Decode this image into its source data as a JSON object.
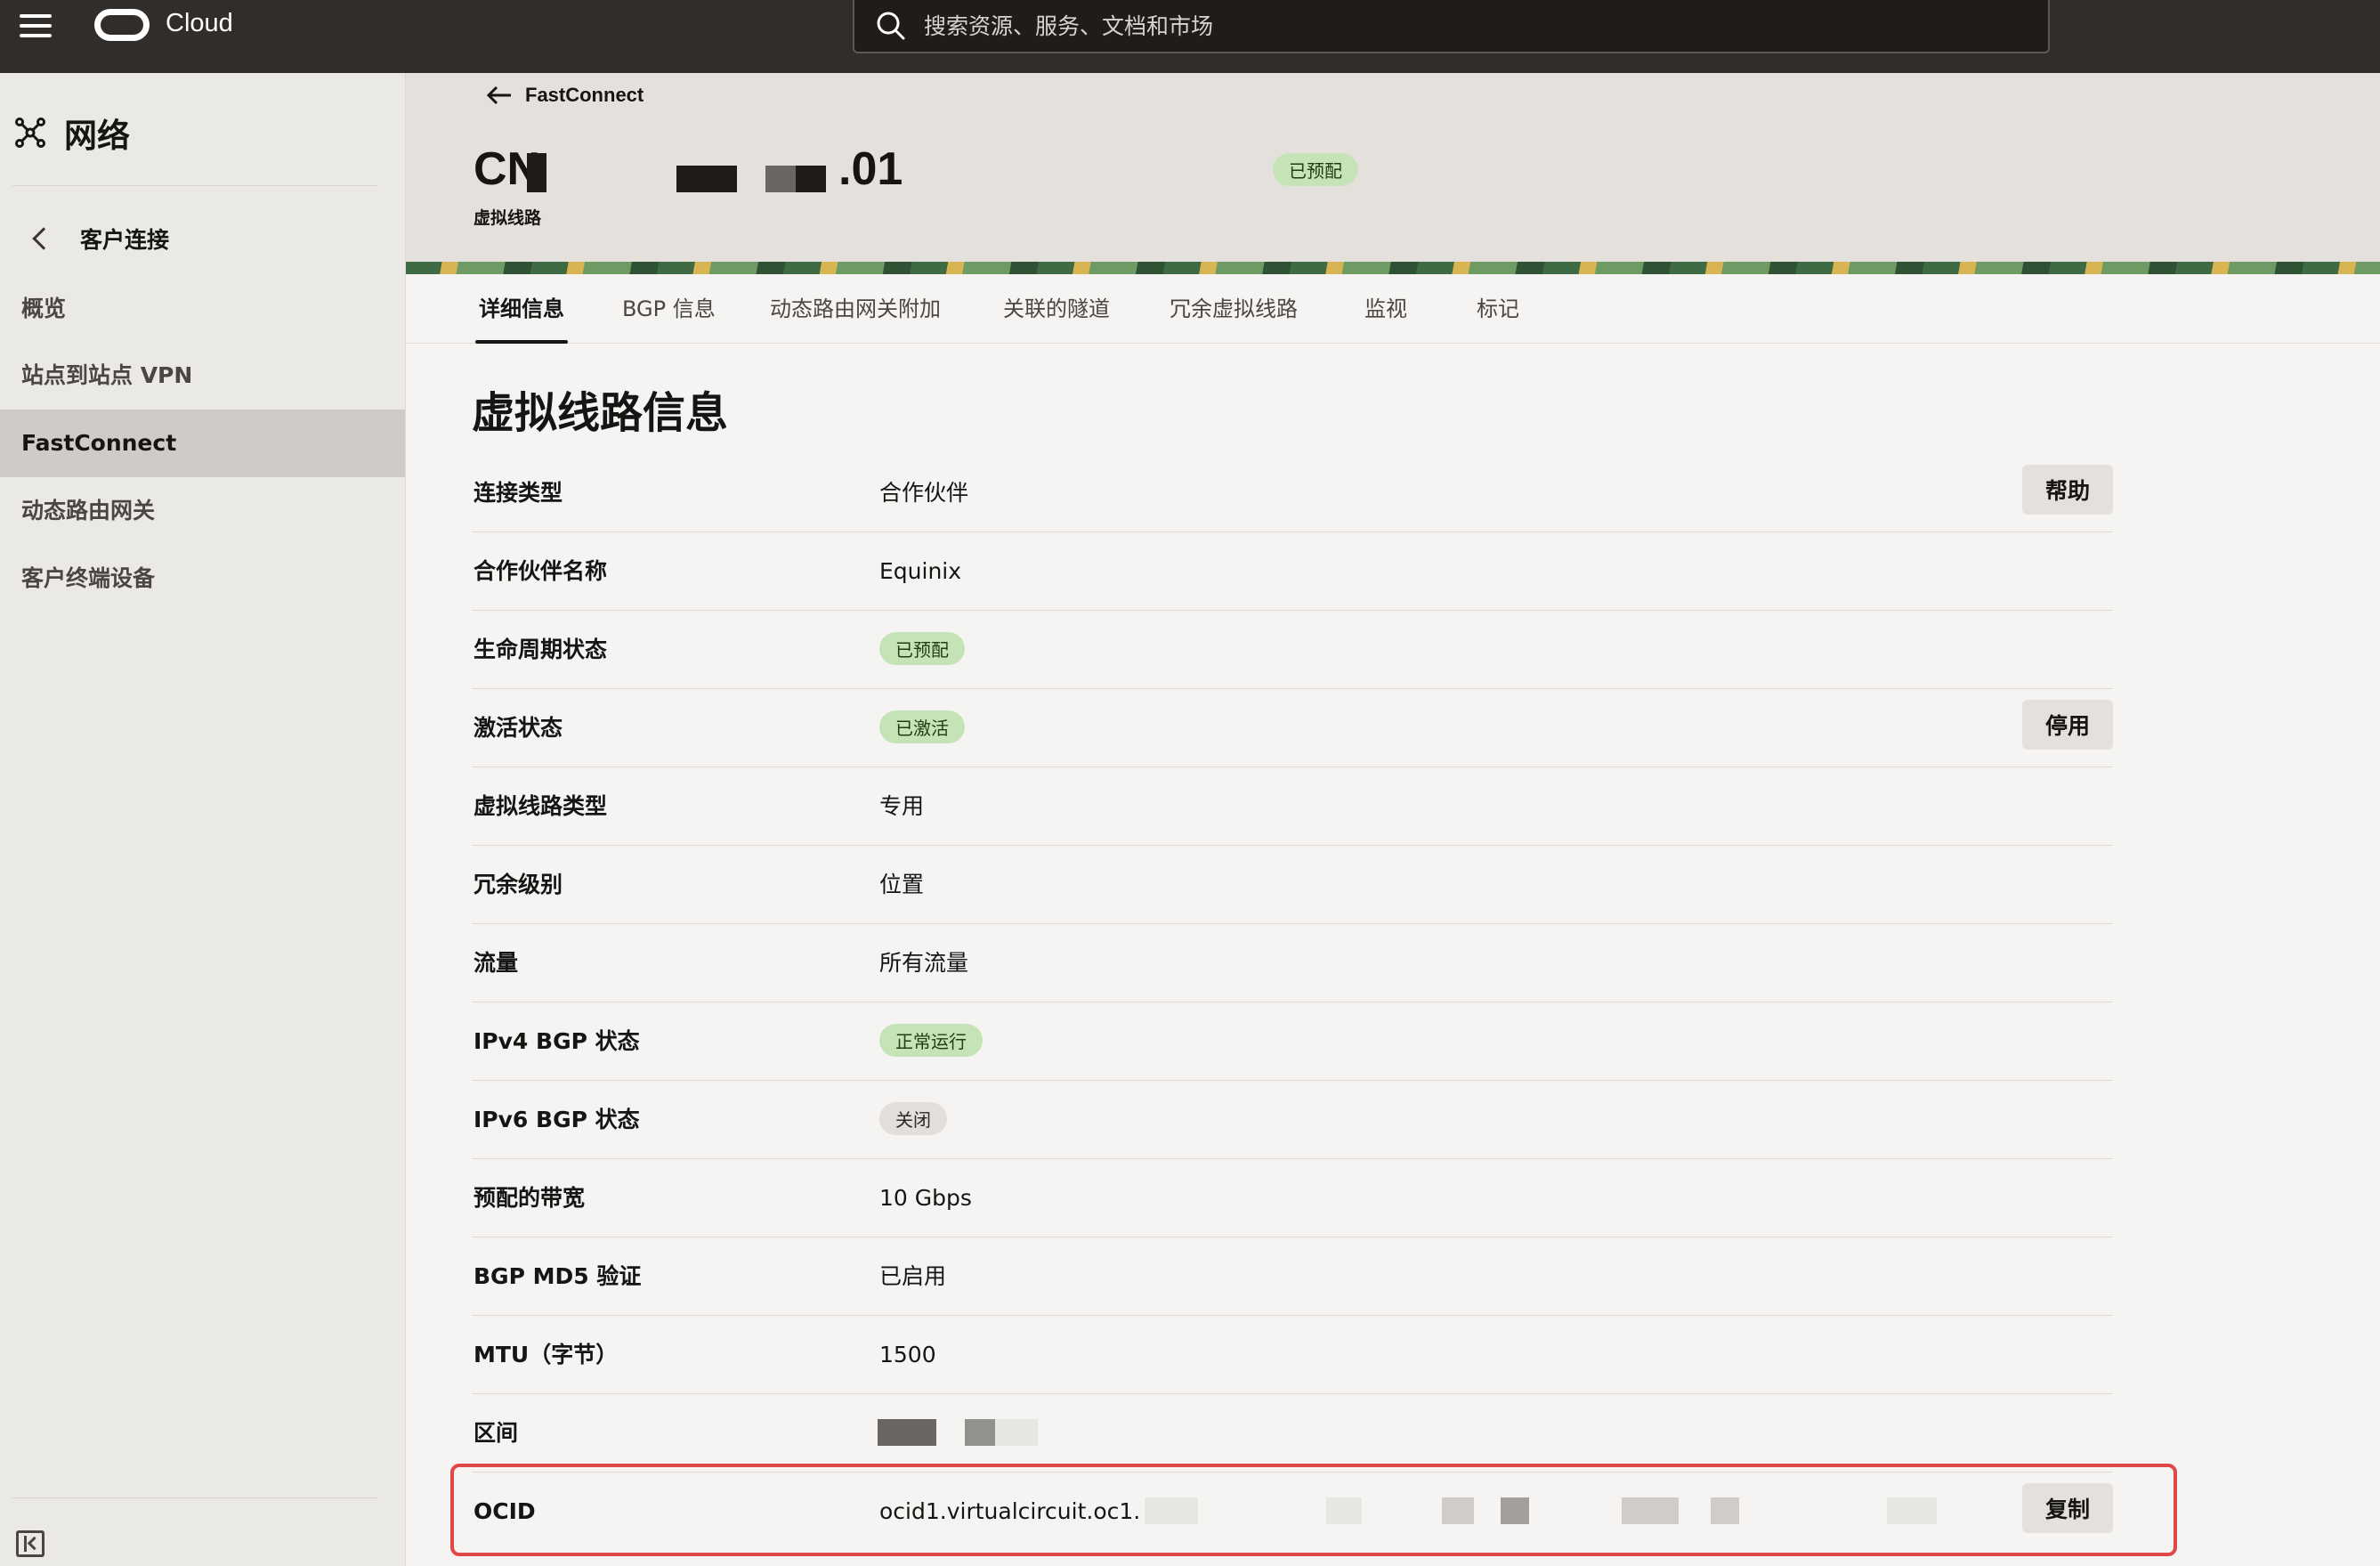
{
  "topbar": {
    "brand": "Cloud",
    "search_placeholder": "搜索资源、服务、文档和市场"
  },
  "sidebar": {
    "title": "网络",
    "back_label": "客户连接",
    "items": [
      {
        "label": "概览"
      },
      {
        "label": "站点到站点 VPN"
      },
      {
        "label": "FastConnect",
        "active": true
      },
      {
        "label": "动态路由网关"
      },
      {
        "label": "客户终端设备"
      }
    ]
  },
  "header": {
    "back_label": "FastConnect",
    "title_start": "CN",
    "title_end": ".01",
    "subtitle": "虚拟线路",
    "status_badge": "已预配"
  },
  "tabs": [
    {
      "label": "详细信息",
      "active": true
    },
    {
      "label": "BGP 信息"
    },
    {
      "label": "动态路由网关附加"
    },
    {
      "label": "关联的隧道"
    },
    {
      "label": "冗余虚拟线路"
    },
    {
      "label": "监视"
    },
    {
      "label": "标记"
    }
  ],
  "section": {
    "title": "虚拟线路信息",
    "help_button": "帮助",
    "deactivate_button": "停用",
    "copy_button": "复制",
    "rows": [
      {
        "label": "连接类型",
        "value": "合作伙伴"
      },
      {
        "label": "合作伙伴名称",
        "value": "Equinix"
      },
      {
        "label": "生命周期状态",
        "value": "已预配"
      },
      {
        "label": "激活状态",
        "value": "已激活"
      },
      {
        "label": "虚拟线路类型",
        "value": "专用"
      },
      {
        "label": "冗余级别",
        "value": "位置"
      },
      {
        "label": "流量",
        "value": "所有流量"
      },
      {
        "label": "IPv4 BGP 状态",
        "value": "正常运行"
      },
      {
        "label": "IPv6 BGP 状态",
        "value": "关闭"
      },
      {
        "label": "预配的带宽",
        "value": "10 Gbps"
      },
      {
        "label": "BGP MD5 验证",
        "value": "已启用"
      },
      {
        "label": "MTU（字节）",
        "value": "1500"
      },
      {
        "label": "区间",
        "value": ""
      },
      {
        "label": "OCID",
        "value": "ocid1.virtualcircuit.oc1."
      }
    ]
  },
  "colors": {
    "topbar": "#312d2a",
    "success_badge": "#c6e3b8",
    "highlight_border": "#e04848"
  }
}
